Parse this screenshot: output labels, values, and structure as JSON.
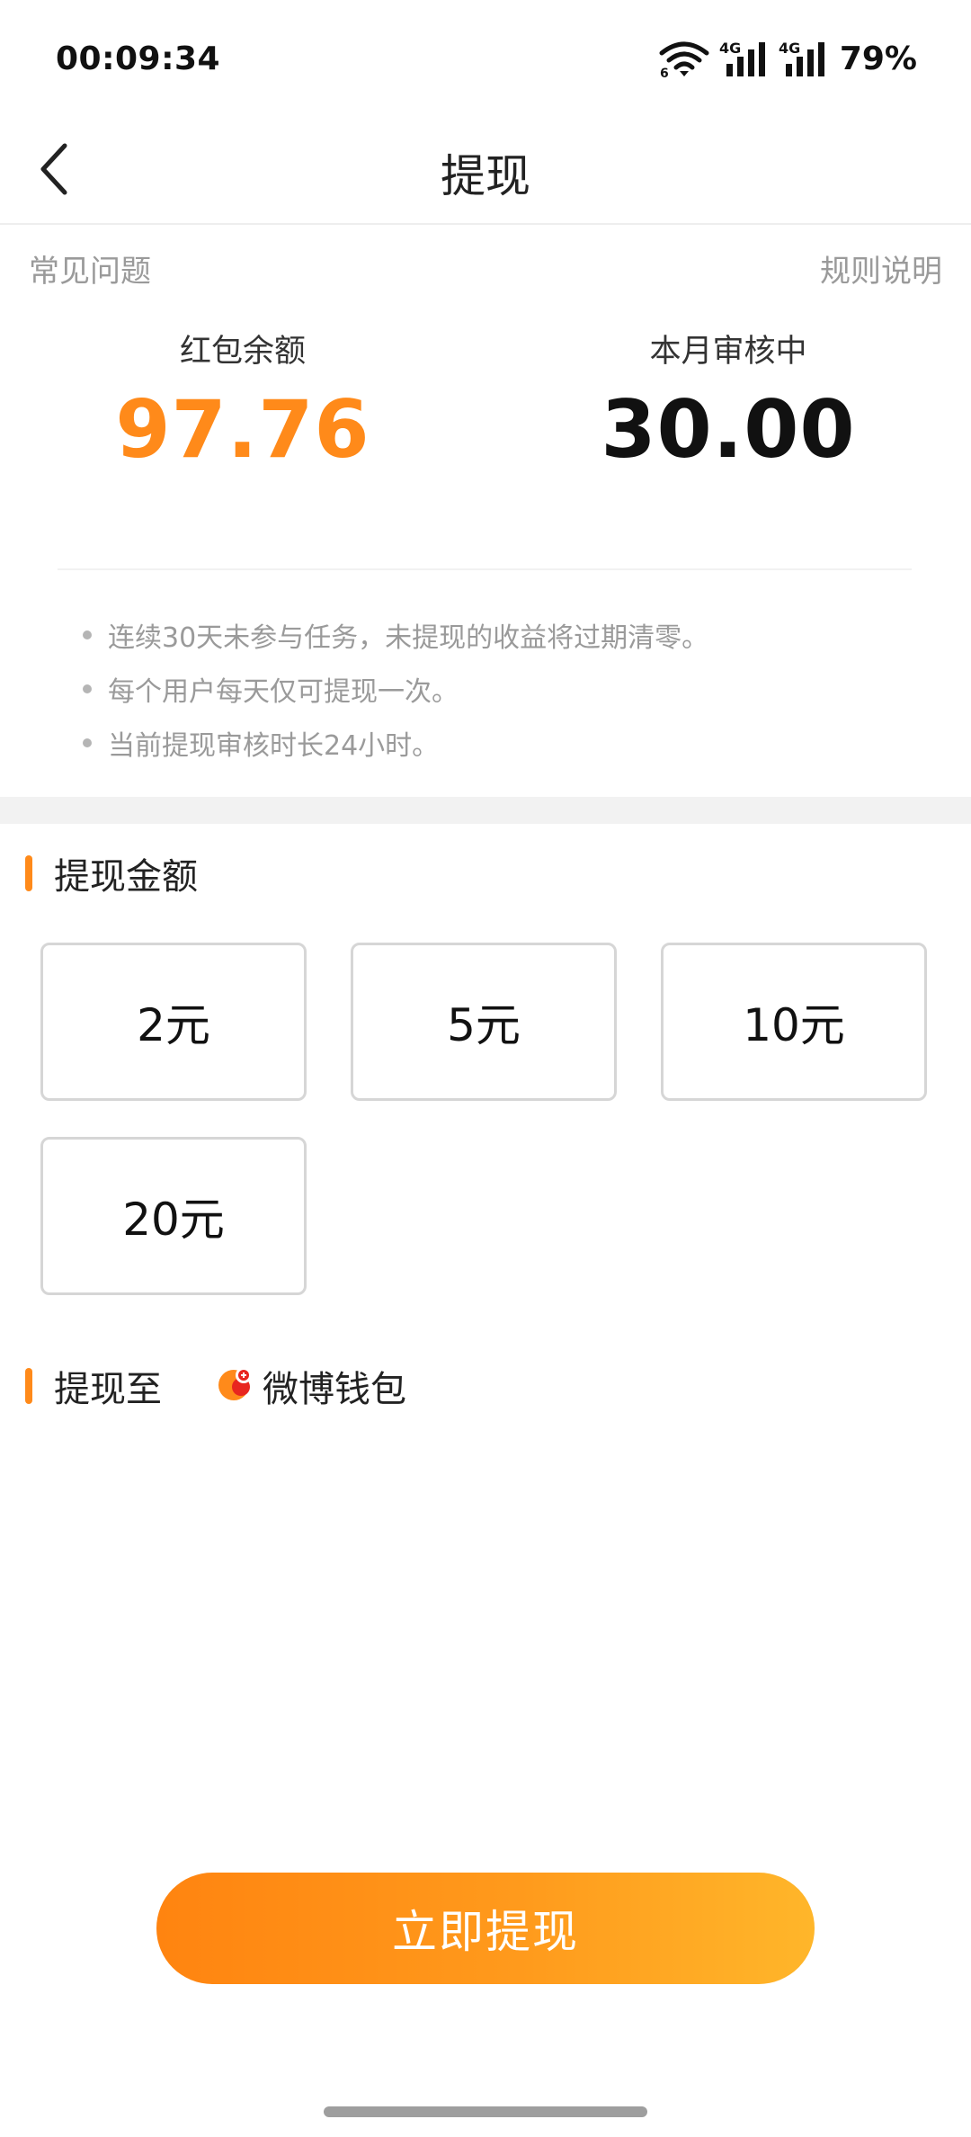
{
  "status_bar": {
    "time": "00:09:34",
    "battery": "79%",
    "network_label_1": "4G",
    "network_label_2": "4G",
    "wifi_label": "6"
  },
  "header": {
    "title": "提现"
  },
  "links": {
    "faq": "常见问题",
    "rules": "规则说明"
  },
  "balance": {
    "red_packet_label": "红包余额",
    "red_packet_value": "97.76",
    "pending_label": "本月审核中",
    "pending_value": "30.00"
  },
  "notes": [
    "连续30天未参与任务，未提现的收益将过期清零。",
    "每个用户每天仅可提现一次。",
    "当前提现审核时长24小时。"
  ],
  "amount_section": {
    "title": "提现金额",
    "options": [
      "2元",
      "5元",
      "10元",
      "20元"
    ]
  },
  "destination_section": {
    "title": "提现至",
    "wallet_name": "微博钱包"
  },
  "cta": {
    "label": "立即提现"
  },
  "colors": {
    "accent": "#ff8a1a",
    "muted_text": "#9a9a9a"
  }
}
